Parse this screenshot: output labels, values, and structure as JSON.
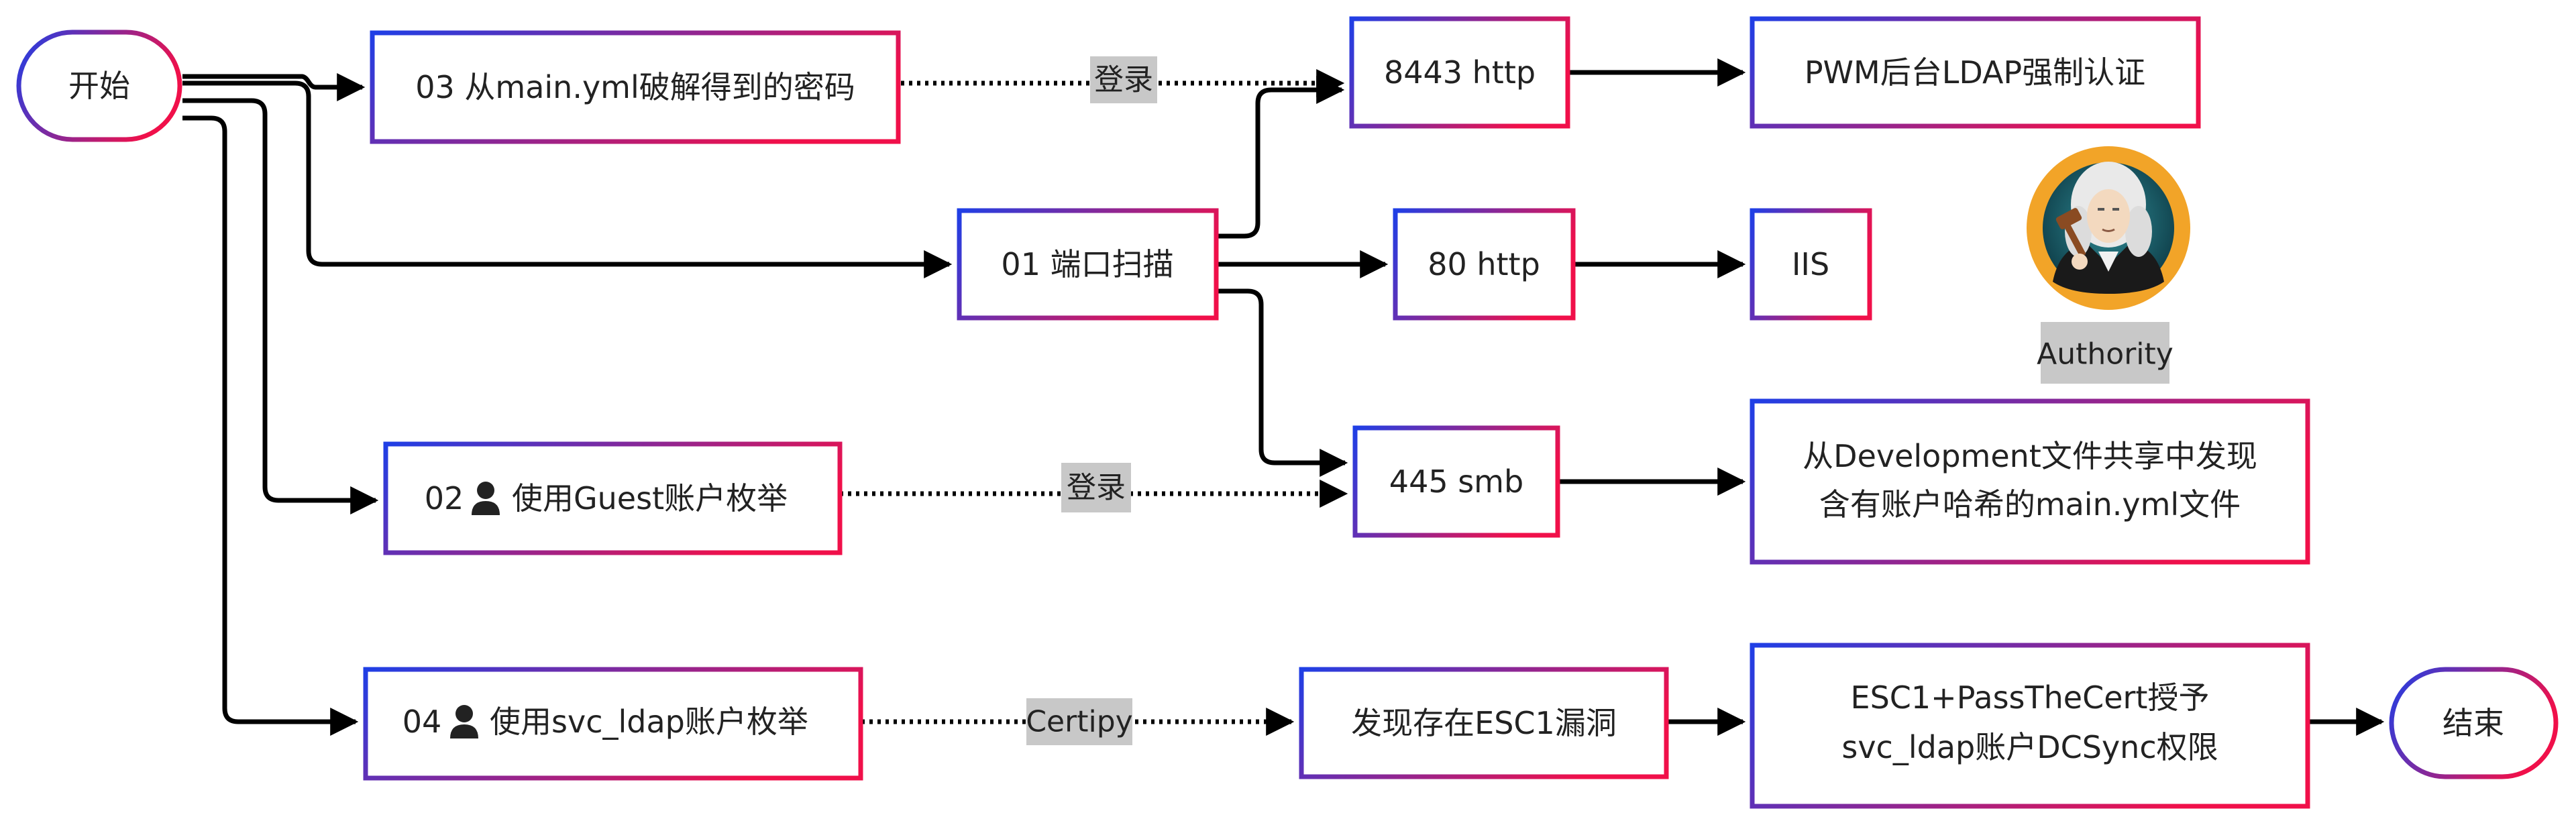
{
  "nodes": {
    "start": "开始",
    "end": "结束",
    "n03": "03 从main.yml破解得到的密码",
    "n01": "01 端口扫描",
    "n02_num": "02",
    "n02_text": "使用Guest账户枚举",
    "n04_num": "04",
    "n04_text": "使用svc_ldap账户枚举",
    "p8443": "8443 http",
    "p80": "80 http",
    "p445": "445 smb",
    "pwm": "PWM后台LDAP强制认证",
    "iis": "IIS",
    "smb_found_line1": "从Development文件共享中发现",
    "smb_found_line2": "含有账户哈希的main.yml文件",
    "esc1": "发现存在ESC1漏洞",
    "pass_line1": "ESC1+PassTheCert授予",
    "pass_line2": "svc_ldap账户DCSync权限"
  },
  "edges": {
    "login_top": "登录",
    "login_mid": "登录",
    "certipy": "Certipy"
  },
  "avatar": {
    "caption": "Authority",
    "icon": "judge-avatar-icon"
  },
  "icons": {
    "user": "user-icon"
  },
  "colors": {
    "gradient_start": "#1f3fe6",
    "gradient_end": "#f0104a",
    "arrow": "#000000",
    "edge_label_bg": "#c8c8c8",
    "avatar_ring": "#f2a428"
  }
}
